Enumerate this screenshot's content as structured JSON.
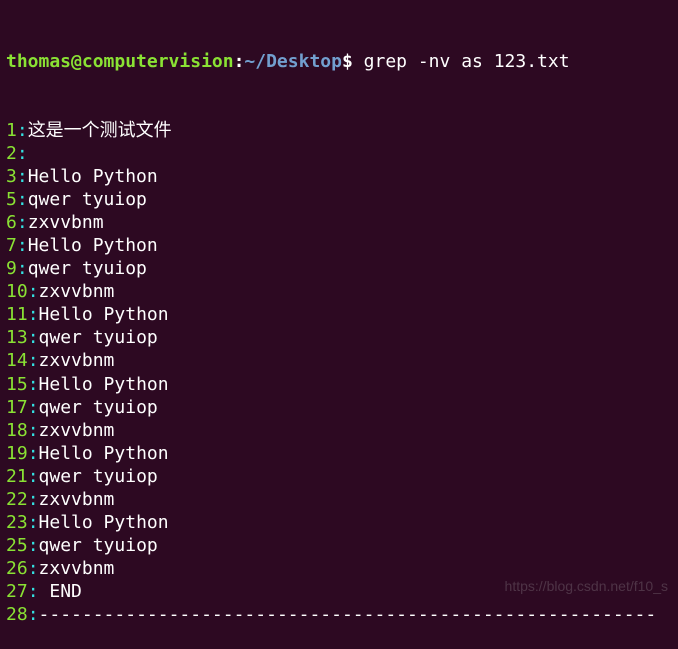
{
  "prompt": {
    "user": "thomas@computervision",
    "colon": ":",
    "path": "~/Desktop",
    "dollar": "$ ",
    "command": "grep -nv as 123.txt"
  },
  "output": [
    {
      "num": "1",
      "sep": ":",
      "content": "这是一个测试文件"
    },
    {
      "num": "2",
      "sep": ":",
      "content": ""
    },
    {
      "num": "3",
      "sep": ":",
      "content": "Hello Python"
    },
    {
      "num": "5",
      "sep": ":",
      "content": "qwer tyuiop"
    },
    {
      "num": "6",
      "sep": ":",
      "content": "zxvvbnm"
    },
    {
      "num": "7",
      "sep": ":",
      "content": "Hello Python"
    },
    {
      "num": "9",
      "sep": ":",
      "content": "qwer tyuiop"
    },
    {
      "num": "10",
      "sep": ":",
      "content": "zxvvbnm"
    },
    {
      "num": "11",
      "sep": ":",
      "content": "Hello Python"
    },
    {
      "num": "13",
      "sep": ":",
      "content": "qwer tyuiop"
    },
    {
      "num": "14",
      "sep": ":",
      "content": "zxvvbnm"
    },
    {
      "num": "15",
      "sep": ":",
      "content": "Hello Python"
    },
    {
      "num": "17",
      "sep": ":",
      "content": "qwer tyuiop"
    },
    {
      "num": "18",
      "sep": ":",
      "content": "zxvvbnm"
    },
    {
      "num": "19",
      "sep": ":",
      "content": "Hello Python"
    },
    {
      "num": "21",
      "sep": ":",
      "content": "qwer tyuiop"
    },
    {
      "num": "22",
      "sep": ":",
      "content": "zxvvbnm"
    },
    {
      "num": "23",
      "sep": ":",
      "content": "Hello Python"
    },
    {
      "num": "25",
      "sep": ":",
      "content": "qwer tyuiop"
    },
    {
      "num": "26",
      "sep": ":",
      "content": "zxvvbnm"
    },
    {
      "num": "27",
      "sep": ":",
      "content": " END"
    },
    {
      "num": "28",
      "sep": ":",
      "content": "---------------------------------------------------------"
    }
  ],
  "watermark": "https://blog.csdn.net/f10_s"
}
